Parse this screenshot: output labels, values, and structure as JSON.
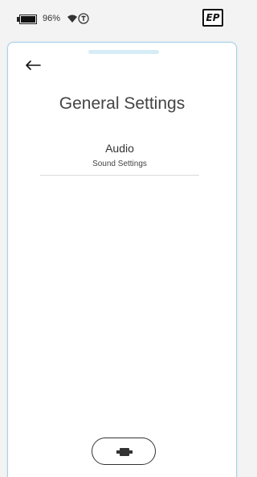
{
  "status_bar": {
    "battery_percent": "96%",
    "battery_icon": "battery-icon",
    "wifi_icon": "wifi-icon",
    "transmitter_icon": "transmitter-icon",
    "logo_text": "EP"
  },
  "screen": {
    "back_icon": "back-arrow-icon",
    "title": "General Settings",
    "menu_items": [
      {
        "title": "Audio",
        "subtitle": "Sound Settings"
      }
    ],
    "bottom_button_icon": "device-connect-icon"
  },
  "colors": {
    "accent": "#a9d2ea",
    "handle": "#d6ecf6",
    "background": "#f3f3f3"
  }
}
